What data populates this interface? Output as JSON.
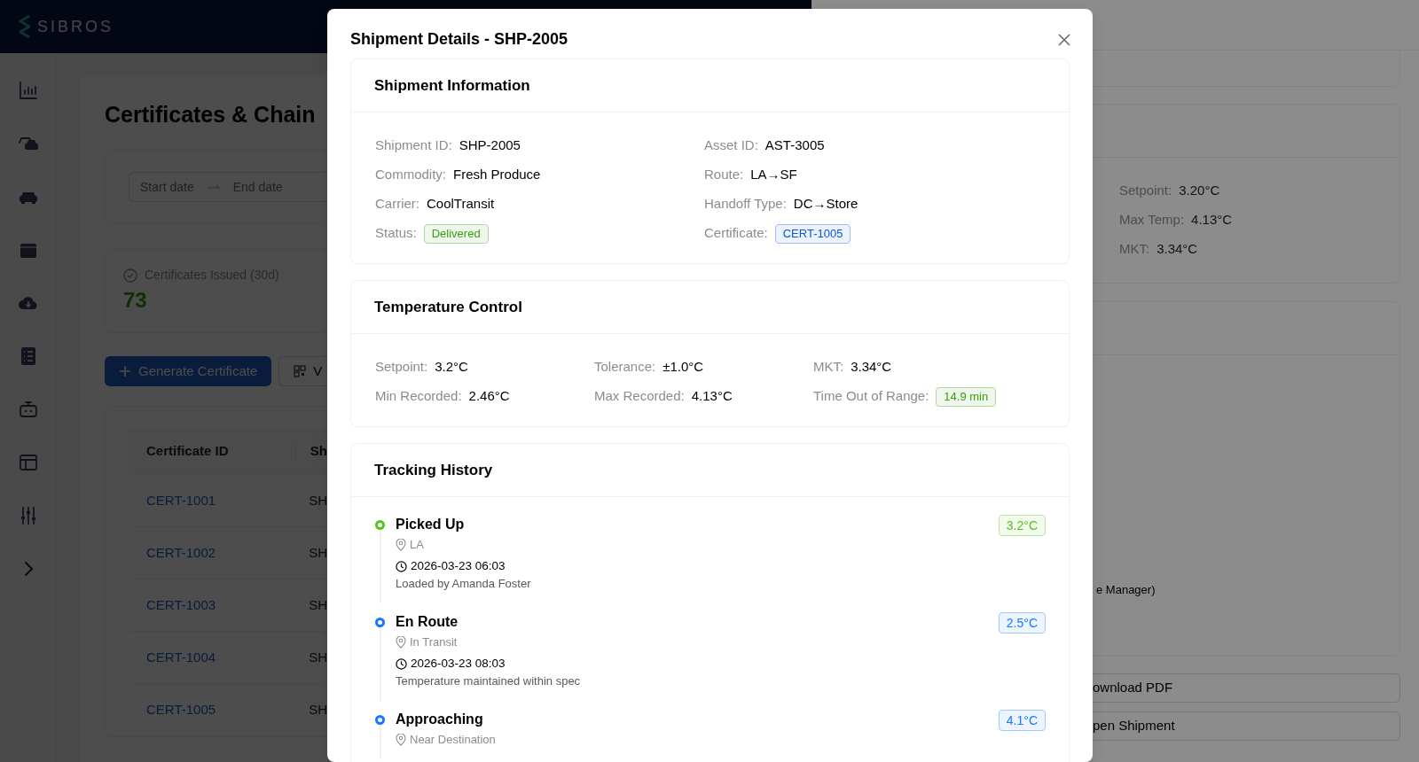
{
  "header": {
    "logo": "SIBROS"
  },
  "page": {
    "title": "Certificates & Chain",
    "date_range": {
      "start_placeholder": "Start date",
      "end_placeholder": "End date"
    },
    "stat": {
      "label": "Certificates Issued (30d)",
      "value": "73"
    },
    "buttons": [
      {
        "label": "Generate Certificate",
        "kind": "primary"
      },
      {
        "label": "V",
        "kind": "qr"
      }
    ],
    "table": {
      "columns": [
        "Certificate ID",
        "Sh"
      ],
      "rows": [
        {
          "certificate_id": "CERT-1001",
          "column_2": "SH"
        },
        {
          "certificate_id": "CERT-1002",
          "column_2": "SH"
        },
        {
          "certificate_id": "CERT-1003",
          "column_2": "SH"
        },
        {
          "certificate_id": "CERT-1004",
          "column_2": "SH"
        },
        {
          "certificate_id": "CERT-1005",
          "column_2": "SH"
        }
      ]
    }
  },
  "drawer": {
    "readings": [
      {
        "label": "Setpoint:",
        "value": "3.20°C"
      },
      {
        "label": "Max Temp:",
        "value": "4.13°C"
      },
      {
        "label": "MKT:",
        "value": "3.34°C"
      }
    ],
    "note": "e Manager)",
    "buttons": [
      "ownload PDF",
      "pen Shipment"
    ]
  },
  "modal": {
    "title": "Shipment Details - SHP-2005",
    "sections": [
      {
        "kind": "info_fields",
        "title": "Shipment Information",
        "fields": [
          {
            "label": "Shipment ID:",
            "value": "SHP-2005",
            "kind": "text"
          },
          {
            "label": "Asset ID:",
            "value": "AST-3005",
            "kind": "text"
          },
          {
            "label": "Commodity:",
            "value": "Fresh Produce",
            "kind": "text"
          },
          {
            "label": "Route:",
            "value": "LA→SF",
            "kind": "text"
          },
          {
            "label": "Carrier:",
            "value": "CoolTransit",
            "kind": "text"
          },
          {
            "label": "Handoff Type:",
            "value": "DC→Store",
            "kind": "text"
          },
          {
            "label": "Status:",
            "value": "Delivered",
            "kind": "tag",
            "color": "#389e0d"
          },
          {
            "label": "Certificate:",
            "value": "CERT-1005",
            "kind": "tag",
            "color": "#0958d9"
          }
        ]
      },
      {
        "kind": "metric_fields",
        "title": "Temperature Control",
        "fields": [
          {
            "label": "Setpoint:",
            "value": "3.2°C",
            "kind": "text"
          },
          {
            "label": "Tolerance:",
            "value": "±1.0°C",
            "kind": "text"
          },
          {
            "label": "MKT:",
            "value": "3.34°C",
            "kind": "text"
          },
          {
            "label": "Min Recorded:",
            "value": "2.46°C",
            "kind": "text"
          },
          {
            "label": "Max Recorded:",
            "value": "4.13°C",
            "kind": "text"
          },
          {
            "label": "Time Out of Range:",
            "value": "14.9 min",
            "kind": "tag",
            "color": "#389e0d"
          }
        ]
      },
      {
        "kind": "timeline",
        "title": "Tracking History",
        "events": [
          {
            "title": "Picked Up",
            "location": "LA",
            "time": "2026-03-23 06:03",
            "note": "Loaded by Amanda Foster",
            "temperature": "3.2°C",
            "color": "#52c41a"
          },
          {
            "title": "En Route",
            "location": "In Transit",
            "time": "2026-03-23 08:03",
            "note": "Temperature maintained within spec",
            "temperature": "2.5°C",
            "color": "#1677ff"
          },
          {
            "title": "Approaching",
            "location": "Near Destination",
            "temperature": "4.1°C",
            "color": "#1677ff"
          }
        ]
      }
    ]
  }
}
